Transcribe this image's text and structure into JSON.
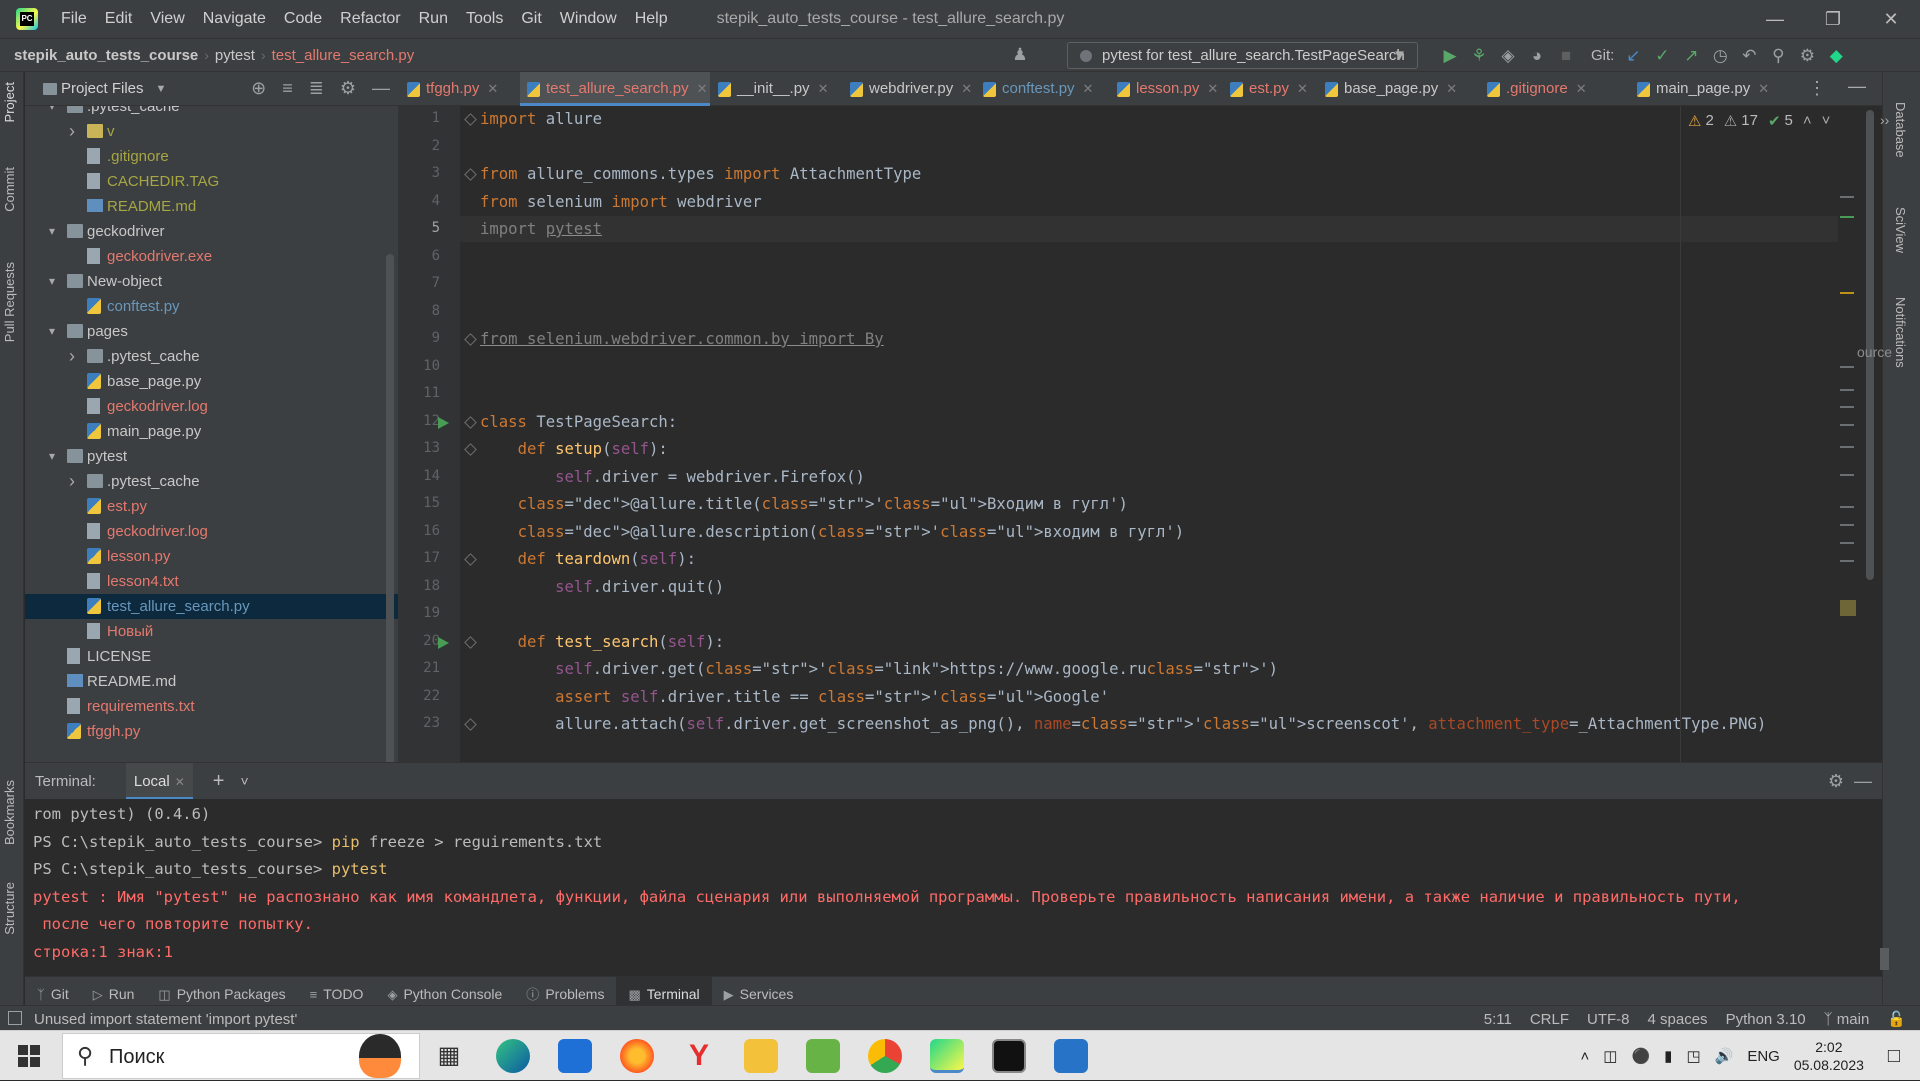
{
  "titlebar": {
    "menu": [
      "File",
      "Edit",
      "View",
      "Navigate",
      "Code",
      "Refactor",
      "Run",
      "Tools",
      "Git",
      "Window",
      "Help"
    ],
    "title": "stepik_auto_tests_course - test_allure_search.py"
  },
  "breadcrumb": [
    "stepik_auto_tests_course",
    "pytest",
    "test_allure_search.py"
  ],
  "run_config": "pytest for test_allure_search.TestPageSearch",
  "git_label": "Git:",
  "left_tools": [
    "Project",
    "Commit",
    "Pull Requests",
    "Bookmarks",
    "Structure"
  ],
  "right_tools": [
    "Database",
    "SciView",
    "Notifications"
  ],
  "project": {
    "header": "Project Files",
    "tree": [
      {
        "label": "v",
        "depth": 2,
        "type": "folder",
        "arrow": "right",
        "color": "ignored"
      },
      {
        "label": ".gitignore",
        "depth": 3,
        "type": "file",
        "color": "ignored"
      },
      {
        "label": "CACHEDIR.TAG",
        "depth": 3,
        "type": "file",
        "color": "ignored"
      },
      {
        "label": "README.md",
        "depth": 3,
        "type": "md",
        "color": "ignored"
      },
      {
        "label": "geckodriver",
        "depth": 1,
        "type": "folder",
        "arrow": "down",
        "color": "norm"
      },
      {
        "label": "geckodriver.exe",
        "depth": 3,
        "type": "file",
        "color": "red"
      },
      {
        "label": "New-object",
        "depth": 1,
        "type": "folder",
        "arrow": "down",
        "color": "norm"
      },
      {
        "label": "conftest.py",
        "depth": 3,
        "type": "py",
        "color": "blue"
      },
      {
        "label": "pages",
        "depth": 1,
        "type": "folder",
        "arrow": "down",
        "color": "norm"
      },
      {
        "label": ".pytest_cache",
        "depth": 2,
        "type": "folder",
        "arrow": "right",
        "color": "norm"
      },
      {
        "label": "base_page.py",
        "depth": 3,
        "type": "py",
        "color": "norm"
      },
      {
        "label": "geckodriver.log",
        "depth": 3,
        "type": "txt",
        "color": "red"
      },
      {
        "label": "main_page.py",
        "depth": 3,
        "type": "py",
        "color": "norm"
      },
      {
        "label": "pytest",
        "depth": 1,
        "type": "folder",
        "arrow": "down",
        "color": "norm"
      },
      {
        "label": ".pytest_cache",
        "depth": 2,
        "type": "folder",
        "arrow": "right",
        "color": "norm"
      },
      {
        "label": "est.py",
        "depth": 3,
        "type": "py",
        "color": "red"
      },
      {
        "label": "geckodriver.log",
        "depth": 3,
        "type": "txt",
        "color": "red"
      },
      {
        "label": "lesson.py",
        "depth": 3,
        "type": "py",
        "color": "red"
      },
      {
        "label": "lesson4.txt",
        "depth": 3,
        "type": "txt",
        "color": "red"
      },
      {
        "label": "test_allure_search.py",
        "depth": 3,
        "type": "py",
        "color": "blue",
        "selected": true
      },
      {
        "label": "Новый",
        "depth": 3,
        "type": "txt",
        "color": "red"
      },
      {
        "label": "LICENSE",
        "depth": 2,
        "type": "txt",
        "color": "norm"
      },
      {
        "label": "README.md",
        "depth": 2,
        "type": "md",
        "color": "norm"
      },
      {
        "label": "requirements.txt",
        "depth": 2,
        "type": "txt",
        "color": "red"
      },
      {
        "label": "tfggh.py",
        "depth": 2,
        "type": "py",
        "color": "red"
      }
    ],
    "top_folder": ".pytest_cache"
  },
  "tabs": [
    {
      "label": "tfggh.py",
      "color": "red"
    },
    {
      "label": "test_allure_search.py",
      "color": "red",
      "active": true
    },
    {
      "label": "__init__.py",
      "color": "norm"
    },
    {
      "label": "webdriver.py",
      "color": "norm"
    },
    {
      "label": "conftest.py",
      "color": "blue"
    },
    {
      "label": "lesson.py",
      "color": "red"
    },
    {
      "label": "est.py",
      "color": "red"
    },
    {
      "label": "base_page.py",
      "color": "norm"
    },
    {
      "label": ".gitignore",
      "color": "red"
    },
    {
      "label": "main_page.py",
      "color": "norm"
    }
  ],
  "inspections": {
    "warnings": "2",
    "weak_warnings": "17",
    "ok": "5"
  },
  "editor": {
    "current_line": 5,
    "lines": [
      "import allure",
      "",
      "from allure_commons.types import AttachmentType",
      "from selenium import webdriver",
      "import pytest",
      "",
      "",
      "",
      "from selenium.webdriver.common.by import By",
      "",
      "",
      "class TestPageSearch:",
      "    def setup(self):",
      "        self.driver = webdriver.Firefox()",
      "    @allure.title('Входим в гугл')",
      "    @allure.description('входим в гугл')",
      "    def teardown(self):",
      "        self.driver.quit()",
      "",
      "    def test_search(self):",
      "        self.driver.get('https://www.google.ru')",
      "        assert self.driver.title == 'Google'",
      "        allure.attach(self.driver.get_screenshot_as_png(), name='screenscot', attachment_type=_AttachmentType.PNG)"
    ],
    "side_text": "ource"
  },
  "terminal": {
    "label": "Terminal:",
    "tab": "Local",
    "lines": [
      {
        "text": "rom pytest) (0.4.6)",
        "kind": "plain"
      },
      {
        "prompt": "PS C:\\stepik_auto_tests_course> ",
        "cmd": "pip",
        "rest": " freeze > reguirements.txt",
        "kind": "cmd"
      },
      {
        "prompt": "PS C:\\stepik_auto_tests_course> ",
        "cmd": "pytest",
        "rest": "",
        "kind": "cmd"
      },
      {
        "text": "pytest : Имя \"pytest\" не распознано как имя командлета, функции, файла сценария или выполняемой программы. Проверьте правильность написания имени, а также наличие и правильность пути,",
        "kind": "err"
      },
      {
        "text": " после чего повторите попытку.",
        "kind": "err"
      },
      {
        "text": "строка:1 знак:1",
        "kind": "err"
      }
    ]
  },
  "bottom_tools": [
    "Git",
    "Run",
    "Python Packages",
    "TODO",
    "Python Console",
    "Problems",
    "Terminal",
    "Services"
  ],
  "status": {
    "message": "Unused import statement 'import pytest'",
    "position": "5:11",
    "line_sep": "CRLF",
    "encoding": "UTF-8",
    "indent": "4 spaces",
    "interpreter": "Python 3.10",
    "branch": "main"
  },
  "taskbar": {
    "search_placeholder": "Поиск",
    "lang": "ENG",
    "time": "2:02",
    "date": "05.08.2023"
  },
  "colors": {
    "accent": "#4a88c7",
    "error": "#ff6b68",
    "keyword": "#cc7832",
    "string": "#6a8759"
  }
}
